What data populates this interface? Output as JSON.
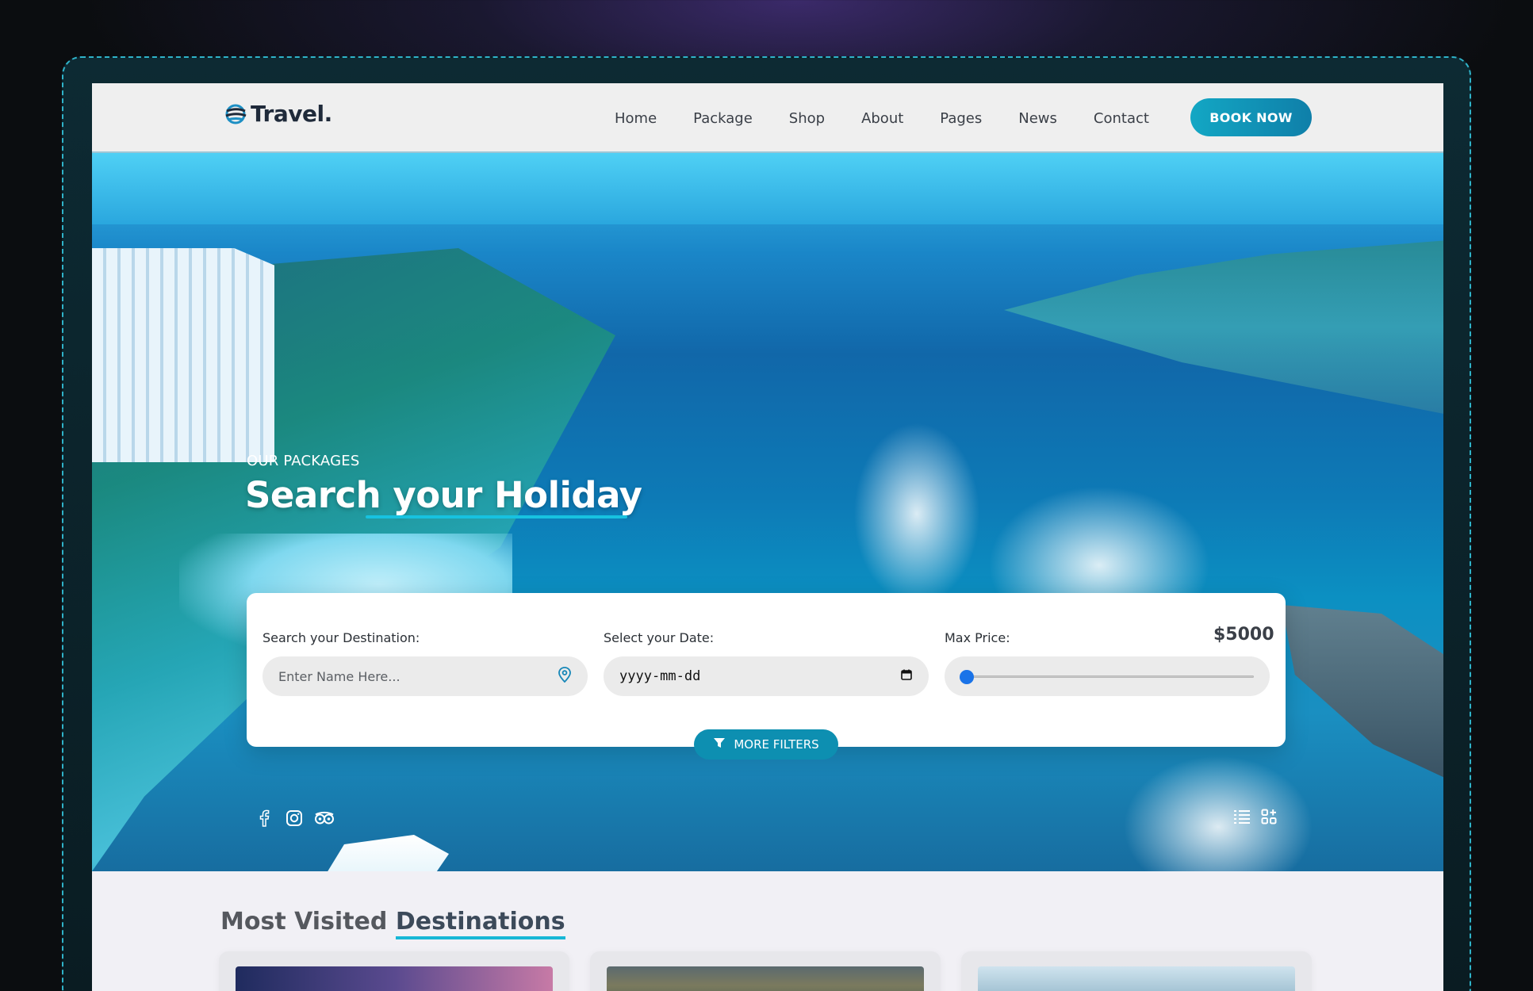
{
  "brand": {
    "name": "Travel."
  },
  "nav": {
    "items": [
      {
        "label": "Home"
      },
      {
        "label": "Package"
      },
      {
        "label": "Shop"
      },
      {
        "label": "About"
      },
      {
        "label": "Pages"
      },
      {
        "label": "News"
      },
      {
        "label": "Contact"
      }
    ],
    "cta_label": "BOOK NOW"
  },
  "hero": {
    "kicker": "OUR PACKAGES",
    "title": "Search your Holiday"
  },
  "search": {
    "destination_label": "Search your Destination:",
    "destination_placeholder": "Enter Name Here...",
    "date_label": "Select your Date:",
    "date_value": "yyyy-mm-dd",
    "price_label": "Max Price:",
    "price_value": "$5000",
    "price_slider_fraction": 0.0,
    "more_filters_label": "MORE FILTERS"
  },
  "socials": [
    "facebook-icon",
    "instagram-icon",
    "tripadvisor-icon"
  ],
  "view_toggles": [
    "list-view-icon",
    "grid-view-icon"
  ],
  "section": {
    "title_plain": "Most Visited ",
    "title_accent": "Destinations"
  },
  "colors": {
    "accent": "#13a7c4",
    "button_dark": "#0d8fb1",
    "slider_thumb": "#1a73e8",
    "title_underline": "#17c2e0"
  }
}
